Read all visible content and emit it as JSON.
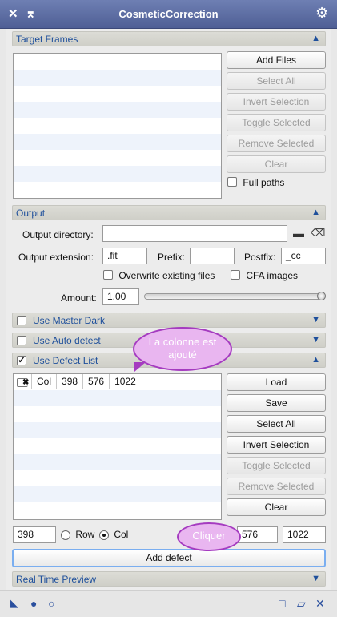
{
  "window": {
    "title": "CosmeticCorrection",
    "close_glyph": "✕",
    "shade_glyph": "⌆",
    "settings_glyph": "⚙"
  },
  "target_frames": {
    "label": "Target Frames",
    "buttons": {
      "add_files": "Add Files",
      "select_all": "Select All",
      "invert_selection": "Invert Selection",
      "toggle_selected": "Toggle Selected",
      "remove_selected": "Remove Selected",
      "clear": "Clear"
    },
    "full_paths": "Full paths"
  },
  "output": {
    "label": "Output",
    "directory_label": "Output directory:",
    "directory_value": "",
    "extension_label": "Output extension:",
    "extension_value": ".fit",
    "prefix_label": "Prefix:",
    "prefix_value": "",
    "postfix_label": "Postfix:",
    "postfix_value": "_cc",
    "overwrite_label": "Overwrite existing files",
    "cfa_label": "CFA images",
    "amount_label": "Amount:",
    "amount_value": "1.00",
    "amount_fraction": 1.0
  },
  "sections": {
    "master_dark": "Use Master Dark",
    "auto_detect": "Use Auto detect",
    "defect_list": "Use Defect List",
    "real_time_preview": "Real Time Preview"
  },
  "defect_list": {
    "rows": [
      {
        "checked": "✖",
        "type": "Col",
        "v1": "398",
        "v2": "576",
        "v3": "1022"
      }
    ],
    "buttons": {
      "load": "Load",
      "save": "Save",
      "select_all": "Select All",
      "invert_selection": "Invert Selection",
      "toggle_selected": "Toggle Selected",
      "remove_selected": "Remove Selected",
      "clear": "Clear"
    },
    "input_value": "398",
    "row_label": "Row",
    "col_label": "Col",
    "start_value": "576",
    "end_value": "1022",
    "add_defect": "Add defect"
  },
  "annotations": {
    "bubble1": "La colonne est ajouté",
    "bubble2": "Cliquer"
  }
}
